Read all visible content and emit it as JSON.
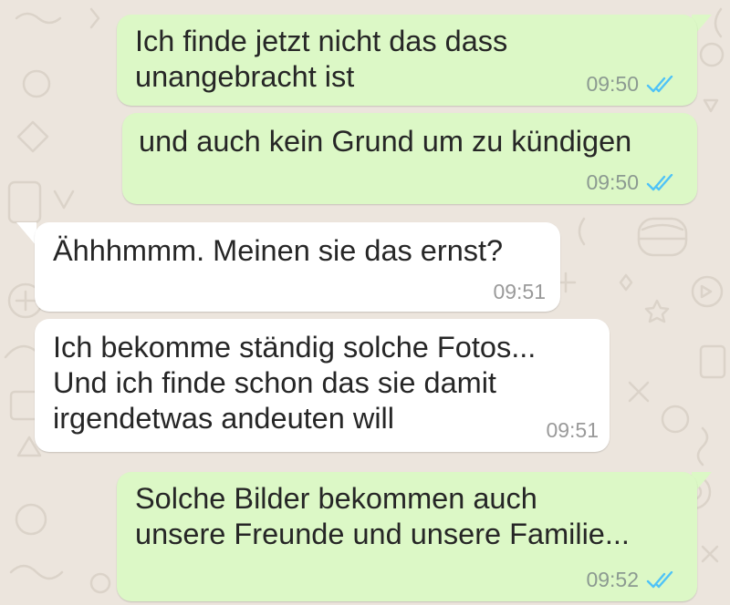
{
  "theme": {
    "wallpaper_color": "#ECE5DD",
    "outgoing_bubble_color": "#DCF8C6",
    "incoming_bubble_color": "#FFFFFF",
    "read_receipt_color": "#4FC3F7"
  },
  "messages": [
    {
      "direction": "outgoing",
      "text": "Ich finde jetzt nicht das dass\nunangebracht ist",
      "time": "09:50",
      "status_icon": "double-check-read-icon"
    },
    {
      "direction": "outgoing",
      "text": "und auch kein Grund um zu kündigen",
      "time": "09:50",
      "status_icon": "double-check-read-icon"
    },
    {
      "direction": "incoming",
      "text": "Ähhhmmm. Meinen sie das ernst?",
      "time": "09:51"
    },
    {
      "direction": "incoming",
      "text": "Ich bekomme ständig solche Fotos...\nUnd ich finde schon das sie damit\nirgendetwas andeuten will",
      "time": "09:51"
    },
    {
      "direction": "outgoing",
      "text": "Solche Bilder bekommen auch\nunsere Freunde und unsere Familie...",
      "time": "09:52",
      "status_icon": "double-check-read-icon"
    }
  ]
}
